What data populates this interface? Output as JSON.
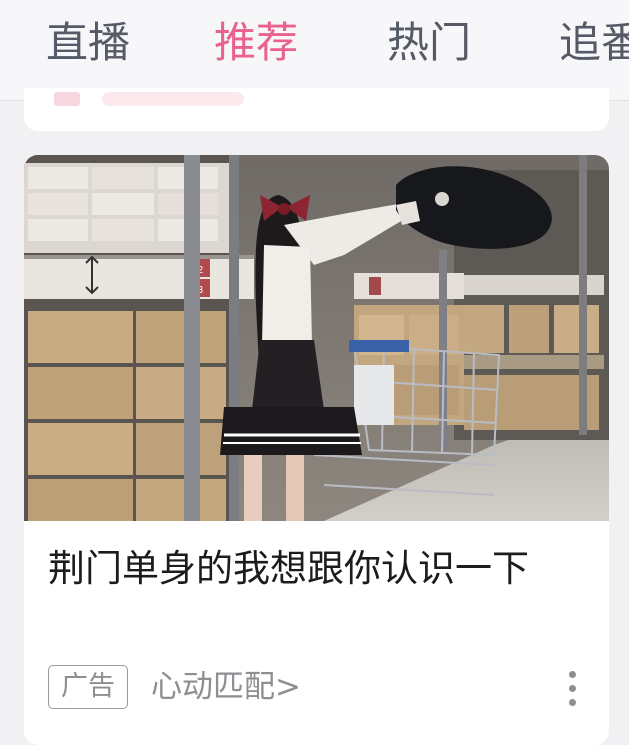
{
  "tabs": [
    {
      "label": "直播",
      "active": false
    },
    {
      "label": "推荐",
      "active": true
    },
    {
      "label": "热门",
      "active": false
    },
    {
      "label": "追番",
      "active": false
    }
  ],
  "accent_color": "#e8628f",
  "feed_card": {
    "title": "荆门单身的我想跟你认识一下",
    "ad_badge": "广告",
    "source_link": "心动匹配>",
    "more_icon": "more-vertical-icon"
  },
  "cover_image": {
    "shelf_labels": [
      "02",
      "13"
    ]
  }
}
